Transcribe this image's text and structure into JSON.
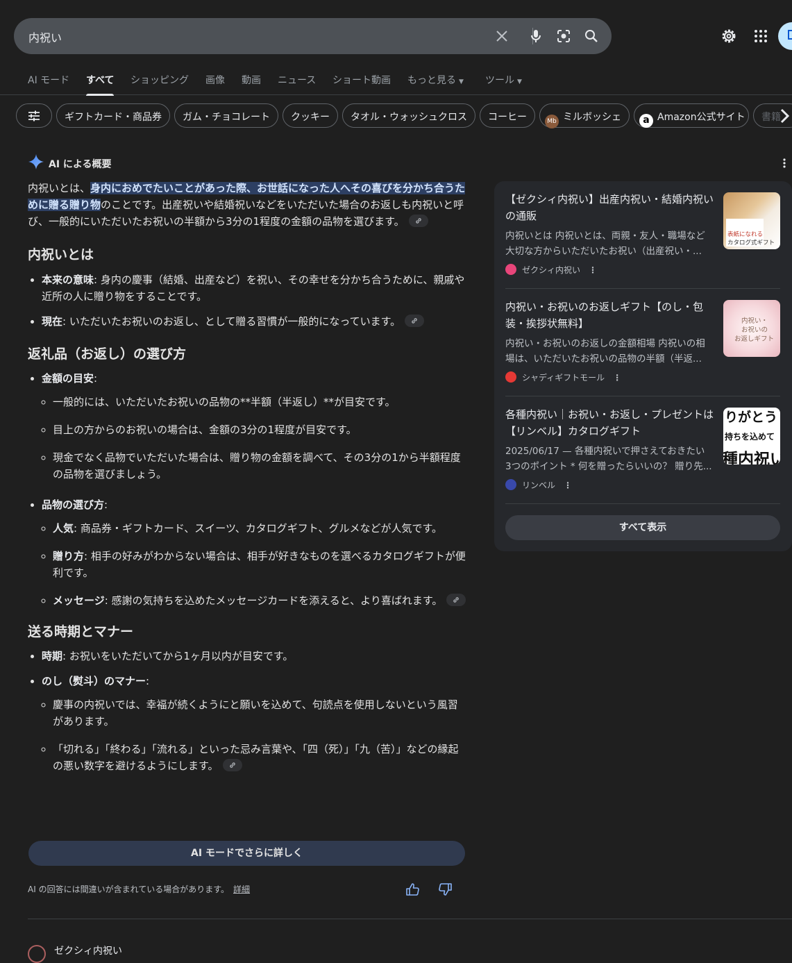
{
  "search": {
    "query": "内祝い"
  },
  "tabs": [
    {
      "label": "AI モード",
      "active": false
    },
    {
      "label": "すべて",
      "active": true
    },
    {
      "label": "ショッピング",
      "active": false
    },
    {
      "label": "画像",
      "active": false
    },
    {
      "label": "動画",
      "active": false
    },
    {
      "label": "ニュース",
      "active": false
    },
    {
      "label": "ショート動画",
      "active": false
    },
    {
      "label": "もっと見る",
      "active": false
    },
    {
      "label": "ツール",
      "active": false
    }
  ],
  "chips": [
    {
      "label": "ギフトカード・商品券"
    },
    {
      "label": "ガム・チョコレート"
    },
    {
      "label": "クッキー"
    },
    {
      "label": "タオル・ウォッシュクロス"
    },
    {
      "label": "コーヒー"
    },
    {
      "label": "ミルボッシェ",
      "icon_text": "Mb"
    },
    {
      "label": "Amazon公式サイト",
      "icon_text": "a"
    },
    {
      "label": "書籍"
    }
  ],
  "ai_overview": {
    "heading": "AI による概要",
    "intro": {
      "prefix": "内祝いとは、",
      "highlight": "身内におめでたいことがあった際、お世話になった人へその喜びを分かち合うために贈る贈り物",
      "rest": "のことです。出産祝いや結婚祝いなどをいただいた場合のお返しも内祝いと呼び、一般的にいただいたお祝いの半額から3分の1程度の金額の品物を選びます。"
    },
    "section1": {
      "title": "内祝いとは",
      "items": [
        {
          "term": "本来の意味",
          "text": ": 身内の慶事（結婚、出産など）を祝い、その幸せを分かち合うために、親戚や近所の人に贈り物をすることです。"
        },
        {
          "term": "現在",
          "text": ": いただいたお祝いのお返し、として贈る習慣が一般的になっています。"
        }
      ]
    },
    "section2": {
      "title": "返礼品（お返し）の選び方",
      "group1": {
        "term": "金額の目安",
        "suffix": ":",
        "items": [
          "一般的には、いただいたお祝いの品物の**半額（半返し）**が目安です。",
          "目上の方からのお祝いの場合は、金額の3分の1程度が目安です。",
          "現金でなく品物でいただいた場合は、贈り物の金額を調べて、その3分の1から半額程度の品物を選びましょう。"
        ]
      },
      "group2": {
        "term": "品物の選び方",
        "suffix": ":",
        "items": [
          {
            "term": "人気",
            "text": ": 商品券・ギフトカード、スイーツ、カタログギフト、グルメなどが人気です。"
          },
          {
            "term": "贈り方",
            "text": ": 相手の好みがわからない場合は、相手が好きなものを選べるカタログギフトが便利です。"
          },
          {
            "term": "メッセージ",
            "text": ": 感謝の気持ちを込めたメッセージカードを添えると、より喜ばれます。"
          }
        ]
      }
    },
    "section3": {
      "title": "送る時期とマナー",
      "item1": {
        "term": "時期",
        "text": ": お祝いをいただいてから1ヶ月以内が目安です。"
      },
      "group": {
        "term": "のし（熨斗）のマナー",
        "suffix": ":",
        "items": [
          "慶事の内祝いでは、幸福が続くようにと願いを込めて、句読点を使用しないという風習があります。",
          "「切れる」「終わる」「流れる」といった忌み言葉や、「四（死）」「九（苦）」などの縁起の悪い数字を避けるようにします。"
        ]
      }
    },
    "more_button": "AI モードでさらに詳しく",
    "disclaimer": "AI の回答には間違いが含まれている場合があります。",
    "disclaimer_link": "詳細"
  },
  "sources": [
    {
      "title": "【ゼクシィ内祝い】出産内祝い・結婚内祝いの通販",
      "snippet": "内祝いとは 内祝いとは、両親・友人・職場など大切な方からいただいたお祝い（出産祝い・...",
      "source": "ゼクシィ内祝い",
      "fav_color": "#e8457a",
      "image_text": [
        "表紙になれる",
        "カタログ式ギフト"
      ]
    },
    {
      "title": "内祝い・お祝いのお返しギフト【のし・包装・挨拶状無料】",
      "snippet": "内祝い・お祝いのお返しの金額相場 内祝いの相場は、いただいたお祝いの品物の半額（半返...",
      "source": "シャディギフトモール",
      "fav_color": "#e53935",
      "image_text": [
        "内祝い・",
        "お祝いの",
        "お返しギフト"
      ]
    },
    {
      "title": "各種内祝い｜お祝い・お返し・プレゼントは【リンベル】カタログギフト",
      "snippet": "2025/06/17 — 各種内祝いで押さえておきたい 3つのポイント * 何を贈ったらいいの？ 贈り先...",
      "source": "リンベル",
      "fav_color": "#3949ab",
      "image_text": [
        "りがとう",
        "持ちを込めて",
        "種内祝い"
      ]
    }
  ],
  "show_all": "すべて表示",
  "next_result_peek": "ゼクシィ内祝い"
}
